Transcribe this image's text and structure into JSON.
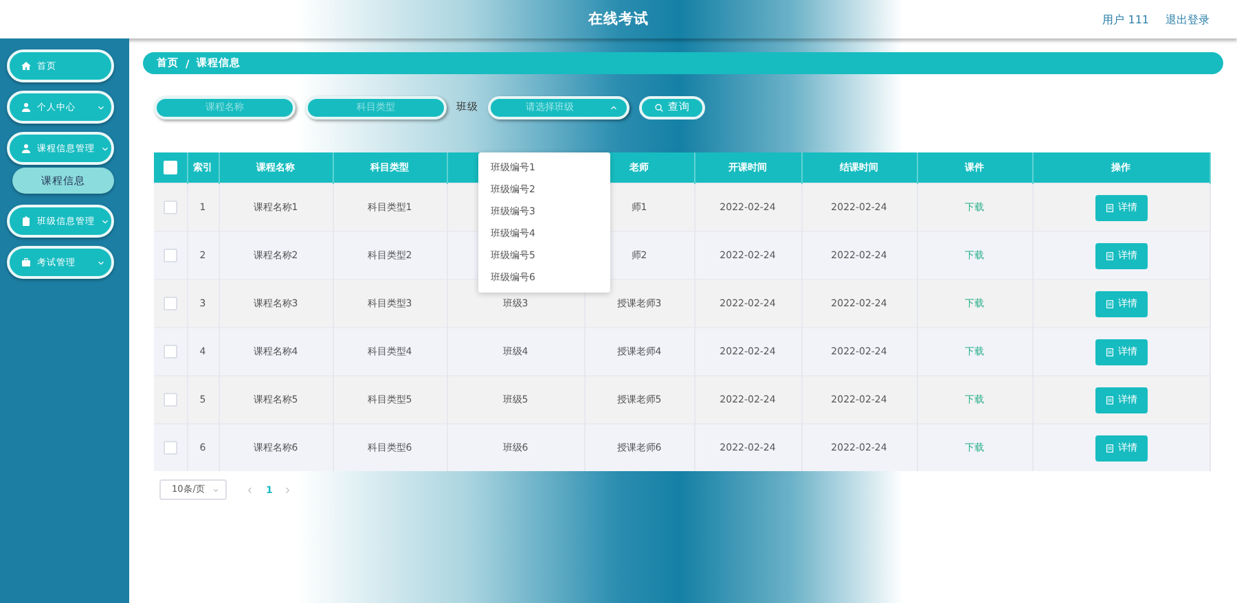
{
  "header": {
    "title": "在线考试",
    "user": "用户 111",
    "logout": "退出登录"
  },
  "sidebar": {
    "items": [
      {
        "label": "首页",
        "kind": "link"
      },
      {
        "label": "个人中心",
        "kind": "submenu"
      },
      {
        "label": "课程信息管理",
        "kind": "submenu",
        "children": [
          {
            "label": "课程信息",
            "selected": true
          }
        ]
      },
      {
        "label": "班级信息管理",
        "kind": "submenu"
      },
      {
        "label": "考试管理",
        "kind": "submenu"
      }
    ]
  },
  "breadcrumb": {
    "items": [
      "首页",
      "课程信息"
    ],
    "separator": "/"
  },
  "search": {
    "fields": [
      {
        "placeholder": "课程名称"
      },
      {
        "placeholder": "科目类型"
      }
    ],
    "class_filter": {
      "label": "班级",
      "placeholder": "请选择班级",
      "expanded": true,
      "options": [
        "班级编号1",
        "班级编号2",
        "班级编号3",
        "班级编号4",
        "班级编号5",
        "班级编号6"
      ]
    },
    "button": "查询"
  },
  "table": {
    "header_checked": false,
    "columns": [
      "索引",
      "课程名称",
      "科目类型",
      null,
      "老师",
      "开课时间",
      "结课时间",
      "课件",
      "操作"
    ],
    "rows": [
      {
        "checked": false,
        "cells": [
          "1",
          "课程名称1",
          "科目类型1",
          null,
          "师1",
          "2022-02-24",
          "2022-02-24",
          "下载",
          "详情"
        ]
      },
      {
        "checked": false,
        "cells": [
          "2",
          "课程名称2",
          "科目类型2",
          null,
          "师2",
          "2022-02-24",
          "2022-02-24",
          "下载",
          "详情"
        ]
      },
      {
        "checked": false,
        "cells": [
          "3",
          "课程名称3",
          "科目类型3",
          "班级3",
          "授课老师3",
          "2022-02-24",
          "2022-02-24",
          "下载",
          "详情"
        ]
      },
      {
        "checked": false,
        "cells": [
          "4",
          "课程名称4",
          "科目类型4",
          "班级4",
          "授课老师4",
          "2022-02-24",
          "2022-02-24",
          "下载",
          "详情"
        ]
      },
      {
        "checked": false,
        "cells": [
          "5",
          "课程名称5",
          "科目类型5",
          "班级5",
          "授课老师5",
          "2022-02-24",
          "2022-02-24",
          "下载",
          "详情"
        ]
      },
      {
        "checked": false,
        "cells": [
          "6",
          "课程名称6",
          "科目类型6",
          "班级6",
          "授课老师6",
          "2022-02-24",
          "2022-02-24",
          "下载",
          "详情"
        ]
      }
    ]
  },
  "pagination": {
    "page_size": "10条/页",
    "pages": [
      {
        "label": "1",
        "selected": true
      }
    ]
  }
}
